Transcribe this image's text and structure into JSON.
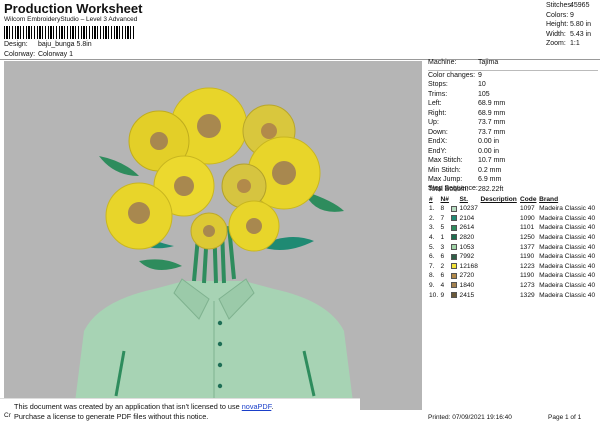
{
  "header": {
    "title": "Production Worksheet",
    "subtitle": "Wilcom EmbroideryStudio – Level 3 Advanced",
    "design_label": "Design:",
    "design_value": "baju_bunga 5.8in",
    "colorway_label": "Colorway:",
    "colorway_value": "Colorway 1"
  },
  "stats": [
    {
      "k": "Stitches:",
      "v": "45965"
    },
    {
      "k": "Colors:",
      "v": "9"
    },
    {
      "k": "Height:",
      "v": "5.80 in"
    },
    {
      "k": "Width:",
      "v": "5.43 in"
    },
    {
      "k": "Zoom:",
      "v": "1:1"
    }
  ],
  "machine_info": [
    {
      "k": "Machine:",
      "v": "Tajima"
    },
    {
      "k": "Color changes:",
      "v": "9"
    },
    {
      "k": "Stops:",
      "v": "10"
    },
    {
      "k": "Trims:",
      "v": "105"
    },
    {
      "k": "Left:",
      "v": "68.9 mm"
    },
    {
      "k": "Right:",
      "v": "68.9 mm"
    },
    {
      "k": "Up:",
      "v": "73.7 mm"
    },
    {
      "k": "Down:",
      "v": "73.7 mm"
    },
    {
      "k": "EndX:",
      "v": "0.00 in"
    },
    {
      "k": "EndY:",
      "v": "0.00 in"
    },
    {
      "k": "Max Stitch:",
      "v": "10.7 mm"
    },
    {
      "k": "Min Stitch:",
      "v": "0.2 mm"
    },
    {
      "k": "Max Jump:",
      "v": "6.9 mm"
    },
    {
      "k": "Total Bobbin:",
      "v": "282.22ft"
    }
  ],
  "stop_sequence": {
    "title": "Stop Sequence:",
    "headers": [
      "#",
      "N#",
      "",
      "St.",
      "Description",
      "Code",
      "Brand"
    ],
    "rows": [
      {
        "n": "1.",
        "nn": "8",
        "color": "#b7dcc1",
        "st": "10237",
        "desc": "",
        "code": "1097",
        "brand": "Madeira Classic 40"
      },
      {
        "n": "2.",
        "nn": "7",
        "color": "#1f8a73",
        "st": "2104",
        "desc": "",
        "code": "1090",
        "brand": "Madeira Classic 40"
      },
      {
        "n": "3.",
        "nn": "5",
        "color": "#2e8c5d",
        "st": "2614",
        "desc": "",
        "code": "1101",
        "brand": "Madeira Classic 40"
      },
      {
        "n": "4.",
        "nn": "1",
        "color": "#1d6e4e",
        "st": "2820",
        "desc": "",
        "code": "1250",
        "brand": "Madeira Classic 40"
      },
      {
        "n": "5.",
        "nn": "3",
        "color": "#9fd3a6",
        "st": "1053",
        "desc": "",
        "code": "1377",
        "brand": "Madeira Classic 40"
      },
      {
        "n": "6.",
        "nn": "6",
        "color": "#2f5f47",
        "st": "7992",
        "desc": "",
        "code": "1190",
        "brand": "Madeira Classic 40"
      },
      {
        "n": "7.",
        "nn": "2",
        "color": "#f2e33a",
        "st": "12168",
        "desc": "",
        "code": "1223",
        "brand": "Madeira Classic 40"
      },
      {
        "n": "8.",
        "nn": "6",
        "color": "#b28a4a",
        "st": "2720",
        "desc": "",
        "code": "1190",
        "brand": "Madeira Classic 40"
      },
      {
        "n": "9.",
        "nn": "4",
        "color": "#a3814f",
        "st": "1840",
        "desc": "",
        "code": "1273",
        "brand": "Madeira Classic 40"
      },
      {
        "n": "10.",
        "nn": "9",
        "color": "#6b5a3a",
        "st": "2415",
        "desc": "",
        "code": "1329",
        "brand": "Madeira Classic 40"
      }
    ]
  },
  "notice": {
    "line1_pre": "This document was created by an application that isn't licensed to use ",
    "line1_link": "novaPDF",
    "line1_post": ".",
    "line2": "Purchase a license to generate PDF files without this notice."
  },
  "footer": {
    "left": "Cr",
    "printed": "Printed: 07/09/2021 19:16:40",
    "page": "Page 1 of 1"
  },
  "colors": {
    "canvas_bg": "#b5b5b5",
    "shirt": "#a7d3b4",
    "petal": "#e8d52a",
    "center": "#a8884f",
    "leaf": "#2e8c5d"
  }
}
